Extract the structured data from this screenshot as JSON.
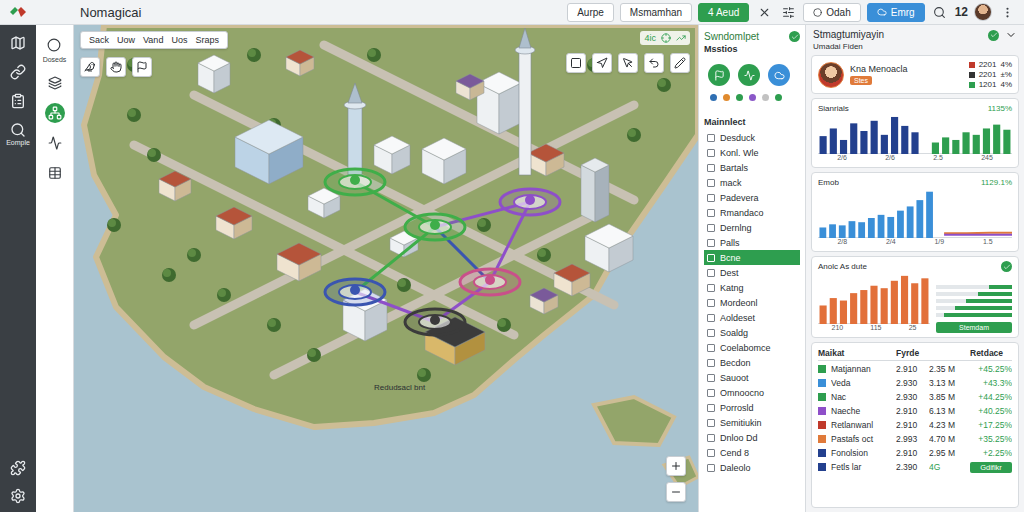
{
  "app": {
    "title": "Nomagicai"
  },
  "topbar": {
    "buttons": [
      {
        "label": "Aurpe",
        "kind": "outline"
      },
      {
        "label": "Msmamhan",
        "kind": "outline"
      },
      {
        "label": "4 Aeud",
        "kind": "green"
      }
    ],
    "secondary": [
      {
        "label": "Odah",
        "kind": "outline"
      },
      {
        "label": "Emrg",
        "kind": "blue"
      }
    ],
    "count": "12"
  },
  "rail": {
    "label": "Eomple"
  },
  "tools": [
    {
      "label": "Doseds",
      "selected": false
    },
    {
      "selected": false
    },
    {
      "selected": true
    },
    {
      "selected": false
    },
    {
      "selected": false
    }
  ],
  "map": {
    "modes": [
      "Sack",
      "Uow",
      "Vand",
      "Uos",
      "Sraps"
    ],
    "status": "4ic",
    "label": "Redudsacl bnt",
    "nodes": [
      {
        "color": "#3fae49"
      },
      {
        "color": "#3fae49"
      },
      {
        "color": "#8e4fc9"
      },
      {
        "color": "#3a55b0"
      },
      {
        "color": "#c9508a"
      },
      {
        "color": "#3b3b3b"
      }
    ],
    "links": [
      {
        "from": 0,
        "to": 1,
        "color": "#3fae49"
      },
      {
        "from": 1,
        "to": 2,
        "color": "#8e4fc9"
      },
      {
        "from": 1,
        "to": 3,
        "color": "#3fae49"
      },
      {
        "from": 3,
        "to": 5,
        "color": "#8e4fc9"
      },
      {
        "from": 5,
        "to": 4,
        "color": "#8e4fc9"
      },
      {
        "from": 4,
        "to": 2,
        "color": "#8e4fc9"
      },
      {
        "from": 1,
        "to": 4,
        "color": "#3a55b0"
      }
    ]
  },
  "panel": {
    "title": "Swndomlpet",
    "subtitle": "Msstios",
    "dots": [
      "#2f6fb3",
      "#e08a2e",
      "#2e9e4f",
      "#8a58c8",
      "#c2c2c2",
      "#2e9e4f"
    ],
    "header": "Mainnlect",
    "items": [
      {
        "label": "Desduck",
        "selected": false
      },
      {
        "label": "Konl. Wle",
        "selected": false
      },
      {
        "label": "Bartals",
        "selected": false
      },
      {
        "label": "mack",
        "selected": false
      },
      {
        "label": "Padevera",
        "selected": false
      },
      {
        "label": "Rmandaco",
        "selected": false
      },
      {
        "label": "Dernlng",
        "selected": false
      },
      {
        "label": "Palls",
        "selected": false
      },
      {
        "label": "Bcne",
        "selected": true
      },
      {
        "label": "Dest",
        "selected": false
      },
      {
        "label": "Katng",
        "selected": false
      },
      {
        "label": "Mordeonl",
        "selected": false
      },
      {
        "label": "Aoldeset",
        "selected": false
      },
      {
        "label": "Soaldg",
        "selected": false
      },
      {
        "label": "Coelabomce",
        "selected": false
      },
      {
        "label": "Becdon",
        "selected": false
      },
      {
        "label": "Sauoot",
        "selected": false
      },
      {
        "label": "Omnoocno",
        "selected": false
      },
      {
        "label": "Porrosld",
        "selected": false
      },
      {
        "label": "Semitiukin",
        "selected": false
      },
      {
        "label": "Dnloo Dd",
        "selected": false
      },
      {
        "label": "Cend 8",
        "selected": false
      },
      {
        "label": "Daleolo",
        "selected": false
      }
    ]
  },
  "insights": {
    "title": "Stmagtumiyayin",
    "subtitle": "Umadai Fiden",
    "profile": {
      "name": "Kna Menoacla",
      "badge": "Stes",
      "stats": [
        {
          "value": "2201",
          "change": "4%",
          "color": "#c0392b"
        },
        {
          "value": "2201",
          "change": "±%",
          "color": "#333333"
        },
        {
          "value": "1201",
          "change": "4%",
          "color": "#2e9e4f"
        }
      ]
    },
    "charts": [
      {
        "title": "Sianrials",
        "value": "1135%",
        "ticks": [
          "2/6",
          "2/6",
          "2.5",
          "245"
        ],
        "bars": [
          {
            "color": "#23408e",
            "values": [
              28,
              40,
              22,
              48,
              36,
              52,
              30,
              58,
              44,
              34
            ]
          },
          {
            "color": "#2e9e4f",
            "values": [
              18,
              26,
              22,
              34,
              30,
              40,
              46,
              38
            ]
          }
        ]
      },
      {
        "title": "Emob",
        "value": "1129.1%",
        "ticks": [
          "2/8",
          "2/4",
          "1/9",
          "1.5"
        ],
        "bars": [
          {
            "color": "#3a8fd8",
            "values": [
              20,
              26,
              24,
              32,
              30,
              38,
              44,
              40,
              52,
              60,
              72,
              88
            ]
          }
        ],
        "lines": [
          {
            "color": "#e07a3a",
            "values": [
              9,
              9,
              10,
              10
            ]
          },
          {
            "color": "#8e4fc9",
            "values": [
              6,
              6,
              6,
              6
            ]
          }
        ]
      }
    ],
    "activity": {
      "title": "Anolc As dute",
      "ticks": [
        "210",
        "115",
        "25"
      ],
      "bars": [
        {
          "color": "#e2703a",
          "values": [
            30,
            42,
            38,
            50,
            55,
            62,
            58,
            70,
            78,
            66,
            74
          ]
        }
      ],
      "meters": [
        {
          "level": 0.3
        },
        {
          "level": 0.45
        },
        {
          "level": 0.6
        },
        {
          "level": 0.75
        },
        {
          "level": 0.9
        }
      ],
      "action": "Stemdam"
    },
    "market": {
      "columns": [
        "Maikat",
        "Fyrde",
        "Retdace"
      ],
      "action": "Gdifikr",
      "rows": [
        {
          "kind": "data",
          "name": "Matjannan",
          "price": "2.910",
          "volume": "2.35 M",
          "change": "+45.25%",
          "color": "#2e9e4f"
        },
        {
          "kind": "data",
          "name": "Veda",
          "price": "2.930",
          "volume": "3.13 M",
          "change": "+43.3%",
          "color": "#3a8fd8"
        },
        {
          "kind": "data",
          "name": "Nac",
          "price": "2.930",
          "volume": "3.85 M",
          "change": "+44.25%",
          "color": "#2e9e4f"
        },
        {
          "kind": "data",
          "name": "Naeche",
          "price": "2.910",
          "volume": "6.13 M",
          "change": "+40.25%",
          "color": "#8e4fc9"
        },
        {
          "kind": "data",
          "name": "Retlanwanl",
          "price": "2.910",
          "volume": "4.23 M",
          "change": "+17.25%",
          "color": "#c0392b"
        },
        {
          "kind": "data",
          "name": "Pastafs oct",
          "price": "2.993",
          "volume": "4.70 M",
          "change": "+35.25%",
          "color": "#e07a3a"
        },
        {
          "kind": "data",
          "name": "Fonolsion",
          "price": "2.910",
          "volume": "2.95 M",
          "change": "+2.25%",
          "color": "#23408e"
        },
        {
          "kind": "action",
          "name": "Fetls lar",
          "price": "2.390",
          "volume": "4G",
          "color": "#23408e"
        }
      ]
    }
  }
}
